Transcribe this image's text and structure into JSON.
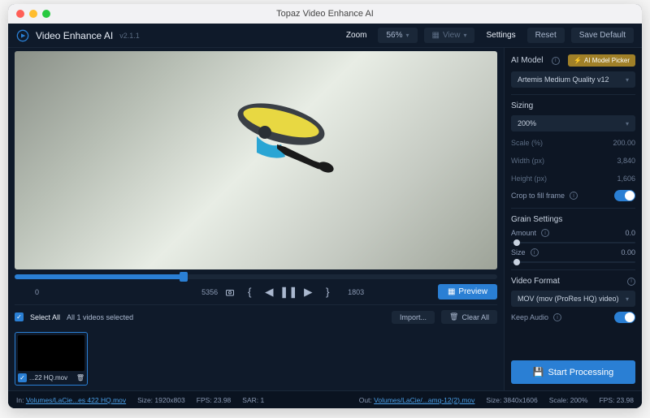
{
  "window": {
    "title": "Topaz Video Enhance AI"
  },
  "header": {
    "app_name": "Video Enhance AI",
    "version": "v2.1.1",
    "zoom_label": "Zoom",
    "zoom_value": "56%",
    "view_label": "View",
    "settings_label": "Settings",
    "reset_label": "Reset",
    "save_default_label": "Save Default"
  },
  "timeline": {
    "start": "0",
    "current": "5356",
    "end": "1803",
    "preview_btn": "Preview"
  },
  "list": {
    "select_all": "Select All",
    "selected_text": "All 1 videos selected",
    "import_btn": "Import...",
    "clear_btn": "Clear All",
    "thumb_name": "...22 HQ.mov"
  },
  "sidebar": {
    "ai_model_label": "AI Model",
    "ai_picker_btn": "AI Model Picker",
    "model_select": "Artemis Medium Quality v12",
    "sizing_label": "Sizing",
    "sizing_select": "200%",
    "scale_label": "Scale (%)",
    "scale_value": "200.00",
    "width_label": "Width (px)",
    "width_value": "3,840",
    "height_label": "Height (px)",
    "height_value": "1,606",
    "crop_label": "Crop to fill frame",
    "grain_label": "Grain Settings",
    "grain_amount_label": "Amount",
    "grain_amount_value": "0.0",
    "grain_size_label": "Size",
    "grain_size_value": "0.00",
    "format_label": "Video Format",
    "format_select": "MOV (mov (ProRes HQ) video)",
    "keep_audio_label": "Keep Audio",
    "start_btn": "Start Processing"
  },
  "status": {
    "in_label": "In:",
    "in_path": "Volumes/LaCie...es 422 HQ.mov",
    "in_size": "Size: 1920x803",
    "in_fps": "FPS: 23.98",
    "in_sar": "SAR: 1",
    "out_label": "Out:",
    "out_path": "Volumes/LaCie/...amq-12(2).mov",
    "out_size": "Size: 3840x1606",
    "out_scale": "Scale: 200%",
    "out_fps": "FPS: 23.98"
  },
  "icons": {
    "camera": "camera-icon",
    "skip_start": "skip-start-icon",
    "step_back": "step-back-icon",
    "pause": "pause-icon",
    "play": "play-icon",
    "trash": "trash-icon",
    "grid": "grid-icon",
    "film": "film-icon",
    "save": "save-icon",
    "bolt": "bolt-icon"
  }
}
